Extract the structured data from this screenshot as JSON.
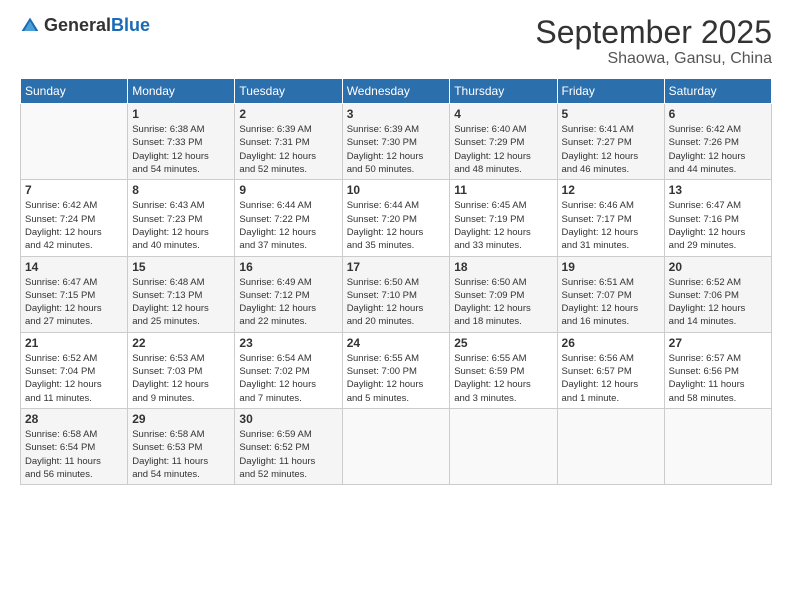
{
  "logo": {
    "general": "General",
    "blue": "Blue"
  },
  "title": "September 2025",
  "location": "Shaowa, Gansu, China",
  "weekdays": [
    "Sunday",
    "Monday",
    "Tuesday",
    "Wednesday",
    "Thursday",
    "Friday",
    "Saturday"
  ],
  "weeks": [
    [
      {
        "day": "",
        "info": ""
      },
      {
        "day": "1",
        "info": "Sunrise: 6:38 AM\nSunset: 7:33 PM\nDaylight: 12 hours\nand 54 minutes."
      },
      {
        "day": "2",
        "info": "Sunrise: 6:39 AM\nSunset: 7:31 PM\nDaylight: 12 hours\nand 52 minutes."
      },
      {
        "day": "3",
        "info": "Sunrise: 6:39 AM\nSunset: 7:30 PM\nDaylight: 12 hours\nand 50 minutes."
      },
      {
        "day": "4",
        "info": "Sunrise: 6:40 AM\nSunset: 7:29 PM\nDaylight: 12 hours\nand 48 minutes."
      },
      {
        "day": "5",
        "info": "Sunrise: 6:41 AM\nSunset: 7:27 PM\nDaylight: 12 hours\nand 46 minutes."
      },
      {
        "day": "6",
        "info": "Sunrise: 6:42 AM\nSunset: 7:26 PM\nDaylight: 12 hours\nand 44 minutes."
      }
    ],
    [
      {
        "day": "7",
        "info": "Sunrise: 6:42 AM\nSunset: 7:24 PM\nDaylight: 12 hours\nand 42 minutes."
      },
      {
        "day": "8",
        "info": "Sunrise: 6:43 AM\nSunset: 7:23 PM\nDaylight: 12 hours\nand 40 minutes."
      },
      {
        "day": "9",
        "info": "Sunrise: 6:44 AM\nSunset: 7:22 PM\nDaylight: 12 hours\nand 37 minutes."
      },
      {
        "day": "10",
        "info": "Sunrise: 6:44 AM\nSunset: 7:20 PM\nDaylight: 12 hours\nand 35 minutes."
      },
      {
        "day": "11",
        "info": "Sunrise: 6:45 AM\nSunset: 7:19 PM\nDaylight: 12 hours\nand 33 minutes."
      },
      {
        "day": "12",
        "info": "Sunrise: 6:46 AM\nSunset: 7:17 PM\nDaylight: 12 hours\nand 31 minutes."
      },
      {
        "day": "13",
        "info": "Sunrise: 6:47 AM\nSunset: 7:16 PM\nDaylight: 12 hours\nand 29 minutes."
      }
    ],
    [
      {
        "day": "14",
        "info": "Sunrise: 6:47 AM\nSunset: 7:15 PM\nDaylight: 12 hours\nand 27 minutes."
      },
      {
        "day": "15",
        "info": "Sunrise: 6:48 AM\nSunset: 7:13 PM\nDaylight: 12 hours\nand 25 minutes."
      },
      {
        "day": "16",
        "info": "Sunrise: 6:49 AM\nSunset: 7:12 PM\nDaylight: 12 hours\nand 22 minutes."
      },
      {
        "day": "17",
        "info": "Sunrise: 6:50 AM\nSunset: 7:10 PM\nDaylight: 12 hours\nand 20 minutes."
      },
      {
        "day": "18",
        "info": "Sunrise: 6:50 AM\nSunset: 7:09 PM\nDaylight: 12 hours\nand 18 minutes."
      },
      {
        "day": "19",
        "info": "Sunrise: 6:51 AM\nSunset: 7:07 PM\nDaylight: 12 hours\nand 16 minutes."
      },
      {
        "day": "20",
        "info": "Sunrise: 6:52 AM\nSunset: 7:06 PM\nDaylight: 12 hours\nand 14 minutes."
      }
    ],
    [
      {
        "day": "21",
        "info": "Sunrise: 6:52 AM\nSunset: 7:04 PM\nDaylight: 12 hours\nand 11 minutes."
      },
      {
        "day": "22",
        "info": "Sunrise: 6:53 AM\nSunset: 7:03 PM\nDaylight: 12 hours\nand 9 minutes."
      },
      {
        "day": "23",
        "info": "Sunrise: 6:54 AM\nSunset: 7:02 PM\nDaylight: 12 hours\nand 7 minutes."
      },
      {
        "day": "24",
        "info": "Sunrise: 6:55 AM\nSunset: 7:00 PM\nDaylight: 12 hours\nand 5 minutes."
      },
      {
        "day": "25",
        "info": "Sunrise: 6:55 AM\nSunset: 6:59 PM\nDaylight: 12 hours\nand 3 minutes."
      },
      {
        "day": "26",
        "info": "Sunrise: 6:56 AM\nSunset: 6:57 PM\nDaylight: 12 hours\nand 1 minute."
      },
      {
        "day": "27",
        "info": "Sunrise: 6:57 AM\nSunset: 6:56 PM\nDaylight: 11 hours\nand 58 minutes."
      }
    ],
    [
      {
        "day": "28",
        "info": "Sunrise: 6:58 AM\nSunset: 6:54 PM\nDaylight: 11 hours\nand 56 minutes."
      },
      {
        "day": "29",
        "info": "Sunrise: 6:58 AM\nSunset: 6:53 PM\nDaylight: 11 hours\nand 54 minutes."
      },
      {
        "day": "30",
        "info": "Sunrise: 6:59 AM\nSunset: 6:52 PM\nDaylight: 11 hours\nand 52 minutes."
      },
      {
        "day": "",
        "info": ""
      },
      {
        "day": "",
        "info": ""
      },
      {
        "day": "",
        "info": ""
      },
      {
        "day": "",
        "info": ""
      }
    ]
  ]
}
